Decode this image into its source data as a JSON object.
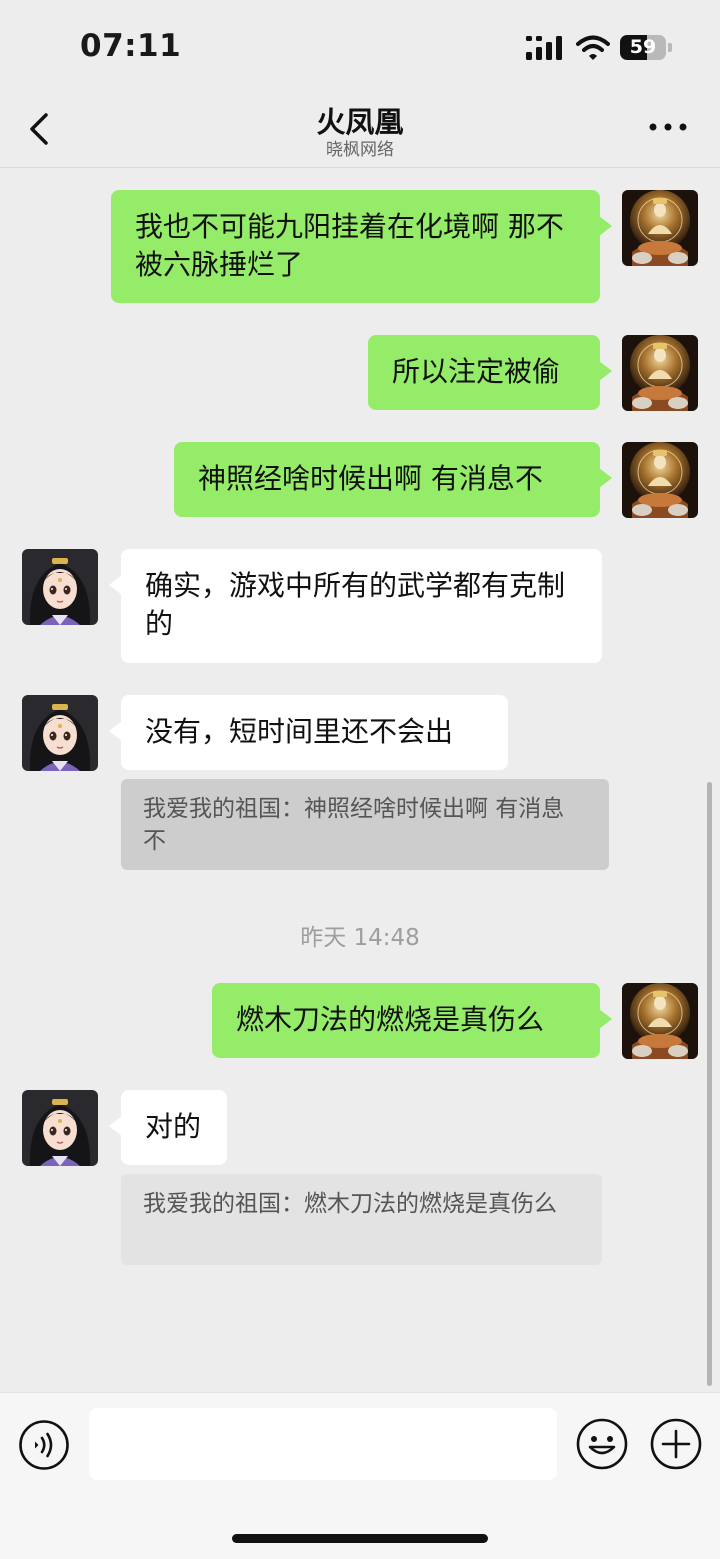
{
  "status_bar": {
    "time": "07:11",
    "battery_percent": 59,
    "battery_label": "59"
  },
  "header": {
    "title": "火凤凰",
    "subtitle": "晓枫网络"
  },
  "messages": [
    {
      "side": "out",
      "text": "我也不可能九阳挂着在化境啊 那不被六脉捶烂了"
    },
    {
      "side": "out",
      "text": "所以注定被偷"
    },
    {
      "side": "out",
      "text": "神照经啥时候出啊 有消息不"
    },
    {
      "side": "in",
      "text": "确实，游戏中所有的武学都有克制的"
    },
    {
      "side": "in",
      "text": "没有，短时间里还不会出",
      "quote": "我爱我的祖国：神照经啥时候出啊 有消息不"
    },
    {
      "type": "timestamp",
      "text": "昨天 14:48"
    },
    {
      "side": "out",
      "text": "燃木刀法的燃烧是真伤么"
    },
    {
      "side": "in",
      "text": "对的",
      "quote": "我爱我的祖国：燃木刀法的燃烧是真伤么"
    }
  ],
  "input_bar": {
    "placeholder": ""
  },
  "colors": {
    "background": "#ededed",
    "outgoing_bubble": "#95ec69",
    "incoming_bubble": "#ffffff",
    "quote_selected": "#cdcdcd",
    "quote": "#e3e3e3"
  },
  "icons": {
    "back": "chevron-left-icon",
    "more": "more-dots-icon",
    "voice": "voice-icon",
    "emoji": "emoji-icon",
    "add": "plus-circle-icon"
  }
}
